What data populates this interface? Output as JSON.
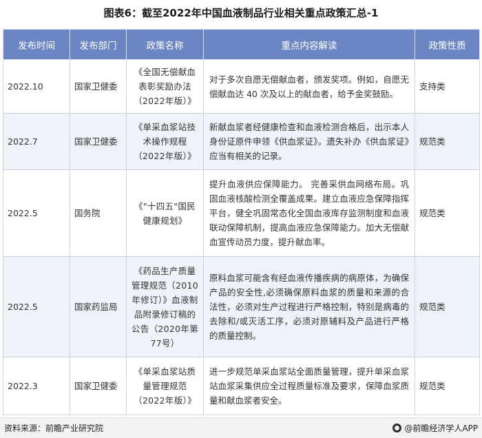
{
  "title": "图表6：截至2022年中国血液制品行业相关重点政策汇总-1",
  "table": {
    "headers": [
      "发布时间",
      "发布部门",
      "政策名称",
      "重点内容解读",
      "政策性质"
    ],
    "rows": [
      {
        "date": "2022.10",
        "dept": "国家卫健委",
        "name": "《全国无偿献血表彰奖励办法（2022年版）》",
        "detail": "对于多次自愿无偿献血者，颁发奖项。例如，自愿无偿献血达 40 次及以上的献血者，给予金奖鼓励。",
        "nature": "支持类"
      },
      {
        "date": "2022.7",
        "dept": "国家卫健委",
        "name": "《单采血浆站技术操作规程（2022年版）》",
        "detail": "新献血浆者经健康检查和血液检测合格后，出示本人身份证原件申领《供血浆证》。遗失补办《供血浆证》应当有相关的记录。",
        "nature": "规范类"
      },
      {
        "date": "2022.5",
        "dept": "国务院",
        "name": "《\"十四五\"国民健康规划》",
        "detail": "提升血液供应保障能力。 完善采供血网络布局。巩固血液核酸检测全覆盖成果。建立血液应急保障指挥平台，健全巩固常态化全国血液库存监测制度和血液联动保障机制，提高血液应急保障能力。加大无偿献血宣传动员力度，提升献血率。",
        "nature": "规范类"
      },
      {
        "date": "2022.5",
        "dept": "国家药监局",
        "name": "《药品生产质量管理规范（2010年修订）》血液制品附录修订稿的公告（2020年第77号）",
        "detail": "原料血浆可能含有经血液传播疾病的病原体，为确保产品的安全性,必须确保原料血浆的质量和来源的合法性，必须对生产过程进行严格控制，特别是病毒的去除和/或灭活工序，必须对原辅料及产品进行严格的质量控制。",
        "nature": "规范类"
      },
      {
        "date": "2022.3",
        "dept": "国家卫健委",
        "name": "《单采血浆站质量管理规范（2022年版）》",
        "detail": "进一步规范单采血浆站全面质量管理，提升单采血浆站血浆采集供应全过程质量标准及要求，保障血浆质量和献血浆者安全。",
        "nature": "规范类"
      }
    ]
  },
  "footer": {
    "source": "资料来源：前瞻产业研究院",
    "brand": "@前瞻经济学人APP"
  }
}
